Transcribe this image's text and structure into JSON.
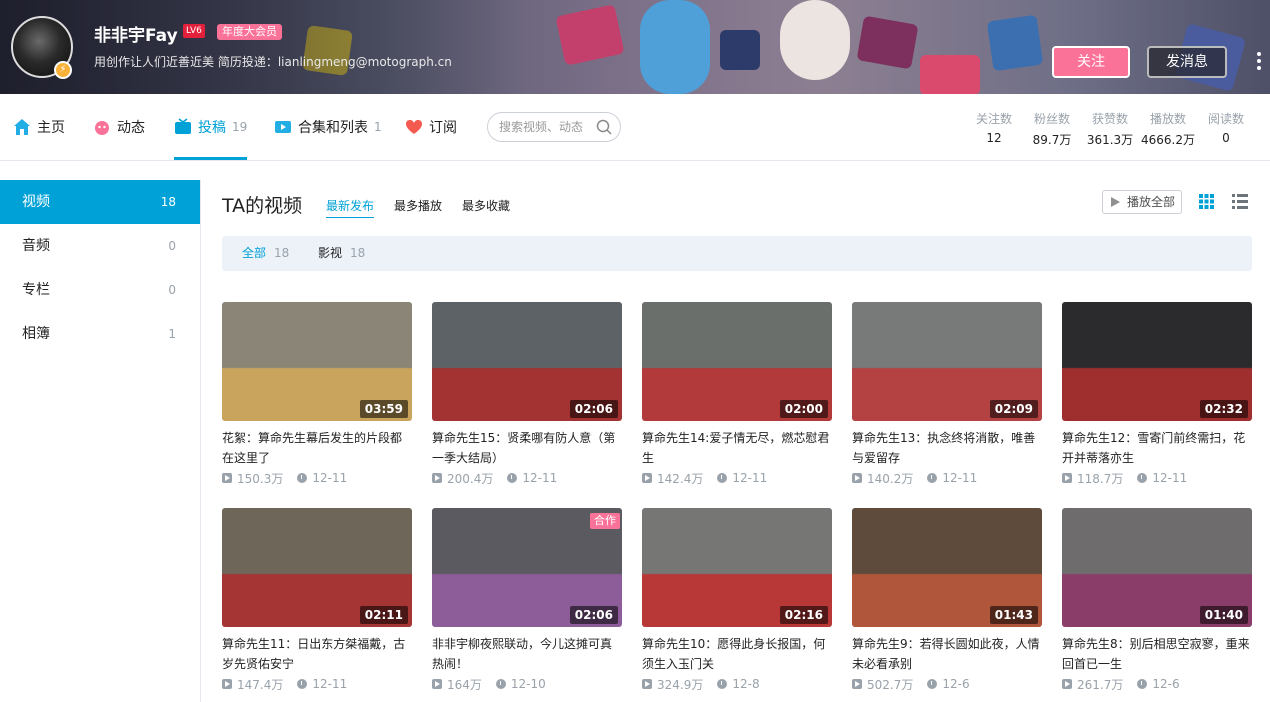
{
  "profile": {
    "username": "非非宇Fay",
    "level": "LV6",
    "vip_label": "年度大会员",
    "sign": "用创作让人们近善近美 简历投递：lianlingmeng@motograph.cn",
    "follow_label": "关注",
    "message_label": "发消息"
  },
  "nav": {
    "items": [
      {
        "label": "主页",
        "count": ""
      },
      {
        "label": "动态",
        "count": ""
      },
      {
        "label": "投稿",
        "count": "19"
      },
      {
        "label": "合集和列表",
        "count": "1"
      },
      {
        "label": "订阅",
        "count": ""
      }
    ],
    "search_placeholder": "搜索视频、动态"
  },
  "stats": [
    {
      "label": "关注数",
      "value": "12"
    },
    {
      "label": "粉丝数",
      "value": "89.7万"
    },
    {
      "label": "获赞数",
      "value": "361.3万"
    },
    {
      "label": "播放数",
      "value": "4666.2万"
    },
    {
      "label": "阅读数",
      "value": "0"
    }
  ],
  "sidebar": {
    "items": [
      {
        "label": "视频",
        "count": "18"
      },
      {
        "label": "音频",
        "count": "0"
      },
      {
        "label": "专栏",
        "count": "0"
      },
      {
        "label": "相簿",
        "count": "1"
      }
    ]
  },
  "main": {
    "title": "TA的视频",
    "sorts": [
      "最新发布",
      "最多播放",
      "最多收藏"
    ],
    "play_all": "播放全部",
    "filters": [
      {
        "label": "全部",
        "count": "18"
      },
      {
        "label": "影视",
        "count": "18"
      }
    ]
  },
  "videos": [
    {
      "title": "花絮：算命先生幕后发生的片段都在这里了",
      "duration": "03:59",
      "views": "150.3万",
      "date": "12-11",
      "badge": "",
      "colors": [
        "#8a8577",
        "#c9a45c"
      ]
    },
    {
      "title": "算命先生15：贤柔哪有防人意（第一季大结局）",
      "duration": "02:06",
      "views": "200.4万",
      "date": "12-11",
      "badge": "",
      "colors": [
        "#5d6266",
        "#a33232"
      ]
    },
    {
      "title": "算命先生14:爱子情无尽，燃芯慰君生",
      "duration": "02:00",
      "views": "142.4万",
      "date": "12-11",
      "badge": "",
      "colors": [
        "#6b6f6c",
        "#b23a3a"
      ]
    },
    {
      "title": "算命先生13：执念终将消散，唯善与爱留存",
      "duration": "02:09",
      "views": "140.2万",
      "date": "12-11",
      "badge": "",
      "colors": [
        "#777a79",
        "#b44242"
      ]
    },
    {
      "title": "算命先生12：雪寄门前终需扫，花开并蒂落亦生",
      "duration": "02:32",
      "views": "118.7万",
      "date": "12-11",
      "badge": "",
      "colors": [
        "#2b2b2e",
        "#9f2e2e"
      ]
    },
    {
      "title": "算命先生11：日出东方桀福戴，古岁先贤佑安宁",
      "duration": "02:11",
      "views": "147.4万",
      "date": "12-11",
      "badge": "",
      "colors": [
        "#6d6659",
        "#a53434"
      ]
    },
    {
      "title": "非非宇柳夜熙联动，今儿这摊可真热闹！",
      "duration": "02:06",
      "views": "164万",
      "date": "12-10",
      "badge": "合作",
      "colors": [
        "#5b5a60",
        "#8d5d9a"
      ]
    },
    {
      "title": "算命先生10：愿得此身长报国，何须生入玉门关",
      "duration": "02:16",
      "views": "324.9万",
      "date": "12-8",
      "badge": "",
      "colors": [
        "#767674",
        "#b83838"
      ]
    },
    {
      "title": "算命先生9：若得长圆如此夜，人情未必看承别",
      "duration": "01:43",
      "views": "502.7万",
      "date": "12-6",
      "badge": "",
      "colors": [
        "#5e4b3b",
        "#b0563a"
      ]
    },
    {
      "title": "算命先生8：别后相思空寂寥，重来回首已一生",
      "duration": "01:40",
      "views": "261.7万",
      "date": "12-6",
      "badge": "",
      "colors": [
        "#6f6c6e",
        "#8a3d68"
      ]
    }
  ]
}
